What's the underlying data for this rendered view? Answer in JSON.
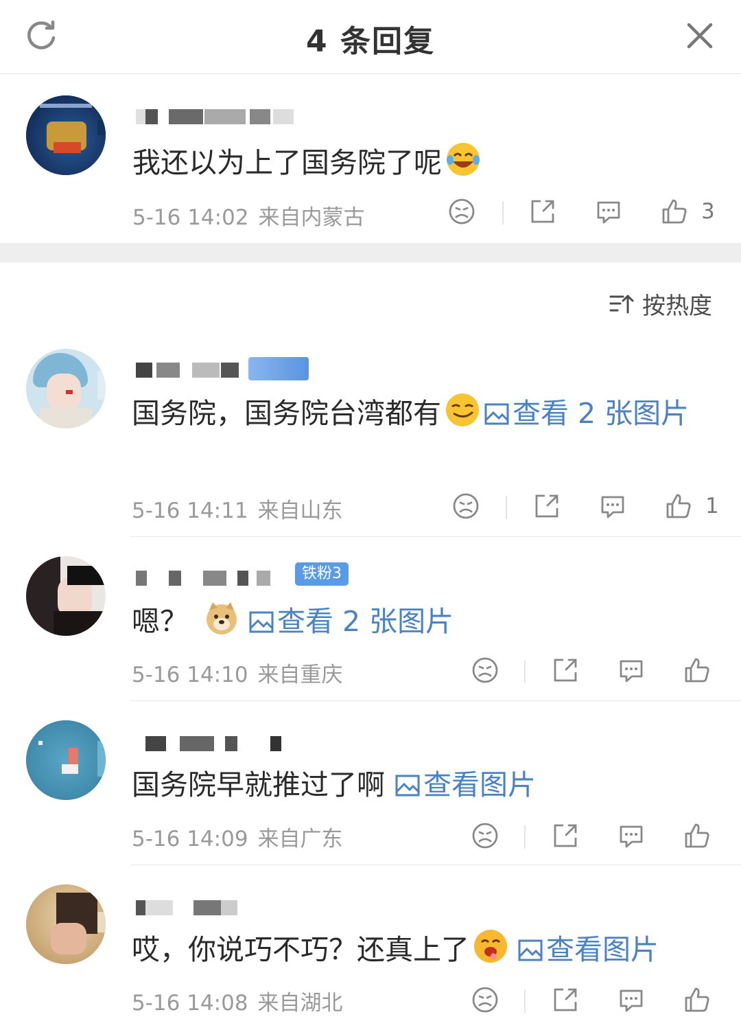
{
  "header": {
    "title": "4 条回复",
    "refresh_icon": "refresh-icon",
    "close_icon": "close-icon"
  },
  "root_comment": {
    "content": "我还以为上了国务院了呢",
    "emoji": "laughing-tears-emoji",
    "time": "5-16 14:02",
    "location": "来自内蒙古",
    "likes": "3"
  },
  "sort": {
    "label": "按热度",
    "icon": "sort-icon"
  },
  "replies": [
    {
      "content": "国务院，国务院台湾都有",
      "emoji": "smirk-emoji",
      "link": "查看 2 张图片",
      "time": "5-16 14:11",
      "location": "来自山东",
      "likes": "1"
    },
    {
      "content": "嗯？",
      "emoji": "doge-emoji",
      "badge": "铁粉3",
      "link": "查看 2 张图片",
      "time": "5-16 14:10",
      "location": "来自重庆",
      "likes": ""
    },
    {
      "content": "国务院早就推过了啊",
      "link": "查看图片",
      "time": "5-16 14:09",
      "location": "来自广东",
      "likes": ""
    },
    {
      "content": "哎，你说巧不巧？还真上了",
      "emoji": "drooling-emoji",
      "link": "查看图片",
      "time": "5-16 14:08",
      "location": "来自湖北",
      "likes": ""
    }
  ],
  "colors": {
    "link": "#4a82c3",
    "meta": "#9a9a9a",
    "separator": "#eeeeee",
    "fan_badge": "#5b9be6"
  }
}
